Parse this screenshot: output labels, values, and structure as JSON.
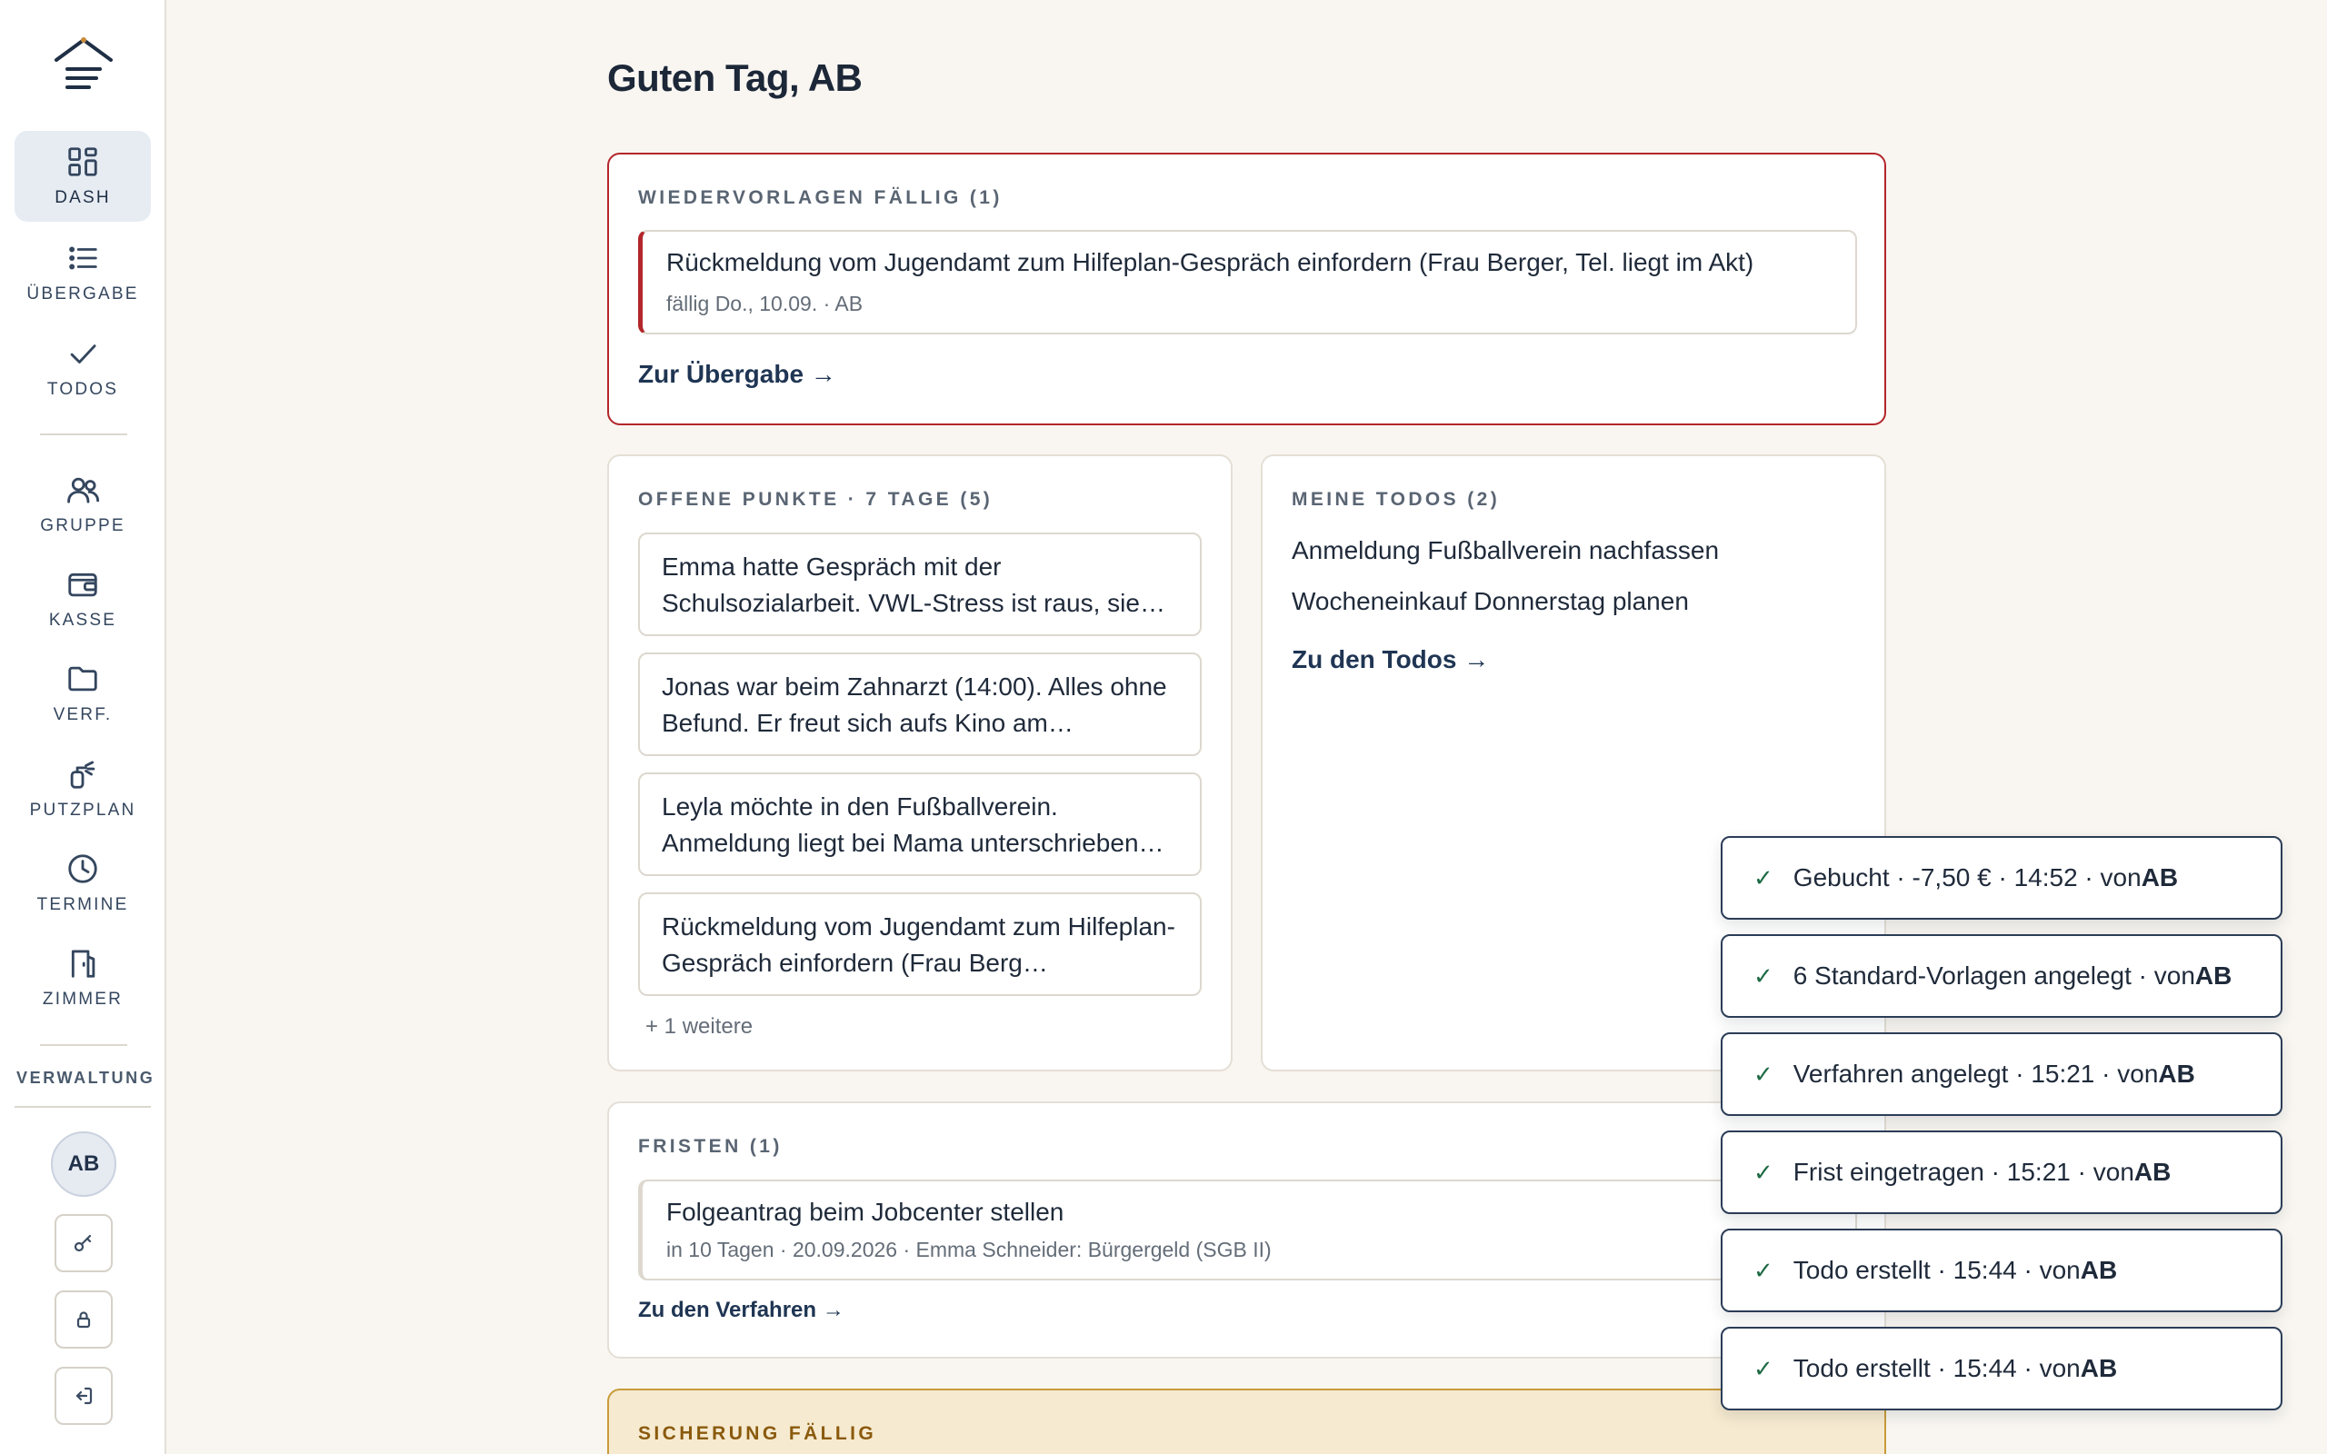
{
  "sidebar": {
    "nav": [
      {
        "label": "DASH",
        "icon": "dashboard-icon",
        "active": true
      },
      {
        "label": "ÜBERGABE",
        "icon": "list-icon"
      },
      {
        "label": "TODOS",
        "icon": "check-icon"
      },
      {
        "label": "GRUPPE",
        "icon": "users-icon"
      },
      {
        "label": "KASSE",
        "icon": "wallet-icon"
      },
      {
        "label": "VERF.",
        "icon": "folder-icon"
      },
      {
        "label": "PUTZPLAN",
        "icon": "spray-icon"
      },
      {
        "label": "TERMINE",
        "icon": "clock-icon"
      },
      {
        "label": "ZIMMER",
        "icon": "door-icon"
      }
    ],
    "section_label": "VERWALTUNG",
    "avatar": "AB"
  },
  "greeting": "Guten Tag, AB",
  "wiedervorlagen": {
    "title": "WIEDERVORLAGEN FÄLLIG (1)",
    "entry_main": "Rückmeldung vom Jugendamt zum Hilfeplan-Gespräch einfordern (Frau Berger, Tel. liegt im Akt)",
    "entry_sub": "fällig Do., 10.09. · AB",
    "link": "Zur Übergabe →"
  },
  "offene_punkte": {
    "title": "OFFENE PUNKTE · 7 TAGE (5)",
    "items": [
      "Emma hatte Gespräch mit der Schulsozialarbeit. VWL-Stress ist raus, sie…",
      "Jonas war beim Zahnarzt (14:00). Alles ohne Befund. Er freut sich aufs Kino am…",
      "Leyla möchte in den Fußballverein. Anmeldung liegt bei Mama unterschrieben…",
      "Rückmeldung vom Jugendamt zum Hilfeplan-Gespräch einfordern (Frau Berg…"
    ],
    "more": "+ 1 weitere"
  },
  "meine_todos": {
    "title": "MEINE TODOS (2)",
    "items": [
      "Anmeldung Fußballverein nachfassen",
      "Wocheneinkauf Donnerstag planen"
    ],
    "link": "Zu den Todos →"
  },
  "fristen": {
    "title": "FRISTEN (1)",
    "entry_main": "Folgeantrag beim Jobcenter stellen",
    "entry_sub": "in 10 Tagen · 20.09.2026 · Emma Schneider: Bürgergeld (SGB II)",
    "link": "Zu den Verfahren →"
  },
  "sicherung": {
    "title": "SICHERUNG FÄLLIG"
  },
  "toasts": [
    {
      "text": "Gebucht · -7,50 € · 14:52 · von ",
      "user": "AB"
    },
    {
      "text": "6 Standard-Vorlagen angelegt · von ",
      "user": "AB"
    },
    {
      "text": "Verfahren angelegt · 15:21 · von ",
      "user": "AB"
    },
    {
      "text": "Frist eingetragen · 15:21 · von ",
      "user": "AB"
    },
    {
      "text": "Todo erstellt · 15:44 · von ",
      "user": "AB"
    },
    {
      "text": "Todo erstellt · 15:44 · von ",
      "user": "AB"
    }
  ],
  "toast_check": "✓",
  "colors": {
    "accent": "#1f3553",
    "alert": "#b3262b",
    "warning_bg": "#f6ead0",
    "success": "#1f6b45",
    "background": "#f9f6f1"
  }
}
